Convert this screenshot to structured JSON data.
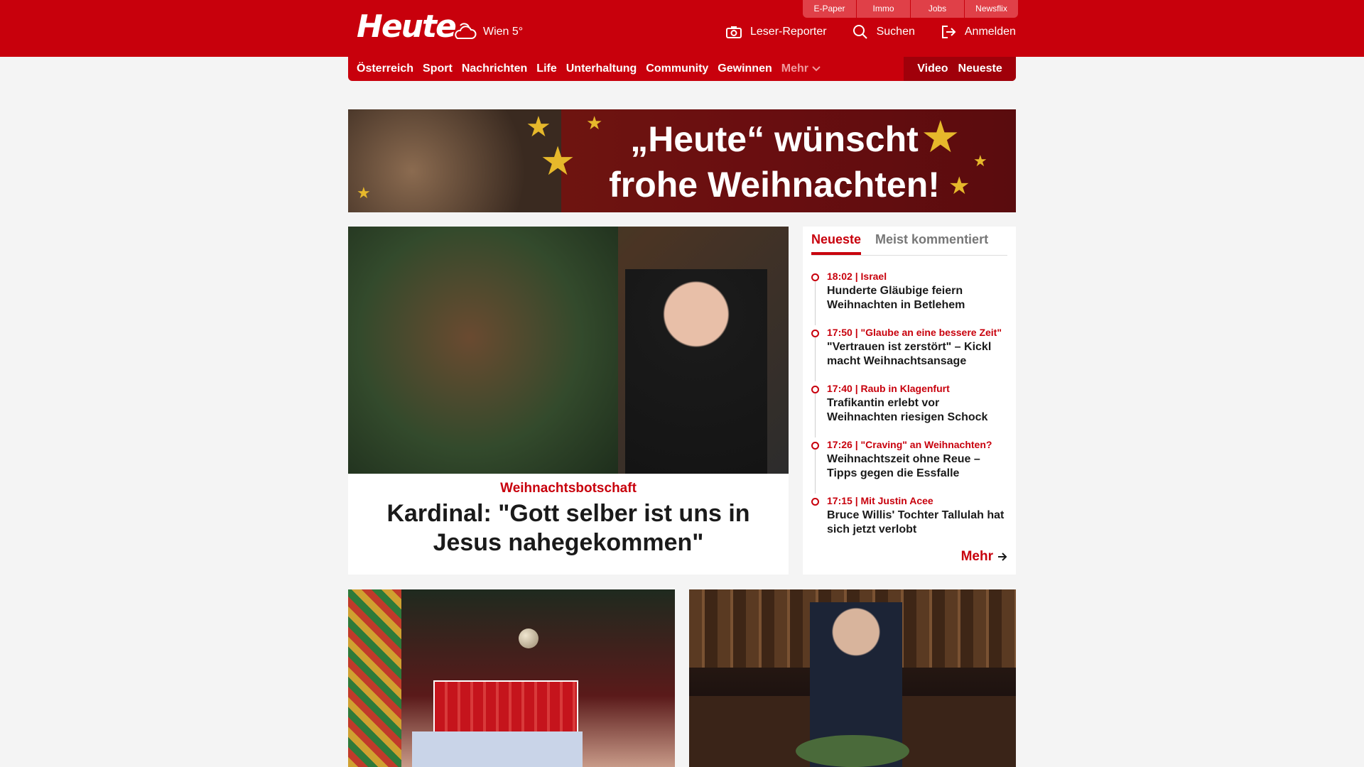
{
  "header": {
    "logo": "Heute",
    "weather": "Wien 5°",
    "tools": [
      {
        "label": "Leser-Reporter",
        "icon": "camera-icon"
      },
      {
        "label": "Suchen",
        "icon": "search-icon"
      },
      {
        "label": "Anmelden",
        "icon": "login-icon"
      }
    ],
    "utility_links": [
      "E-Paper",
      "Immo",
      "Jobs",
      "Newsflix"
    ]
  },
  "nav": {
    "items": [
      "Österreich",
      "Sport",
      "Nachrichten",
      "Life",
      "Unterhaltung",
      "Community",
      "Gewinnen"
    ],
    "more": "Mehr",
    "right": [
      "Video",
      "Neueste"
    ]
  },
  "banner": {
    "line1": "„Heute“ wünscht",
    "line2": "frohe Weihnachten!"
  },
  "hero": {
    "kicker": "Weihnachtsbotschaft",
    "title": "Kardinal: \"Gott selber ist uns in Jesus nahegekommen\""
  },
  "newest": {
    "tabs": [
      "Neueste",
      "Meist kommentiert"
    ],
    "items": [
      {
        "time": "18:02",
        "topic": "Israel",
        "title": "Hunderte Gläubige feiern Weihnachten in Betlehem"
      },
      {
        "time": "17:50",
        "topic": "\"Glaube an eine bessere Zeit\"",
        "title": "\"Vertrauen ist zerstört\" – Kickl macht Weihnachtsansage"
      },
      {
        "time": "17:40",
        "topic": "Raub in Klagenfurt",
        "title": "Trafikantin erlebt vor Weihnachten riesigen Schock"
      },
      {
        "time": "17:26",
        "topic": "\"Craving\" an Weihnachten?",
        "title": "Weihnachtszeit ohne Reue – Tipps gegen die Essfalle"
      },
      {
        "time": "17:15",
        "topic": "Mit Justin Acee",
        "title": "Bruce Willis' Tochter Tallulah hat sich jetzt verlobt"
      }
    ],
    "more": "Mehr"
  },
  "colors": {
    "brand": "#c8000c",
    "brand_dark": "#a0000a",
    "background": "#f4f4f4"
  }
}
